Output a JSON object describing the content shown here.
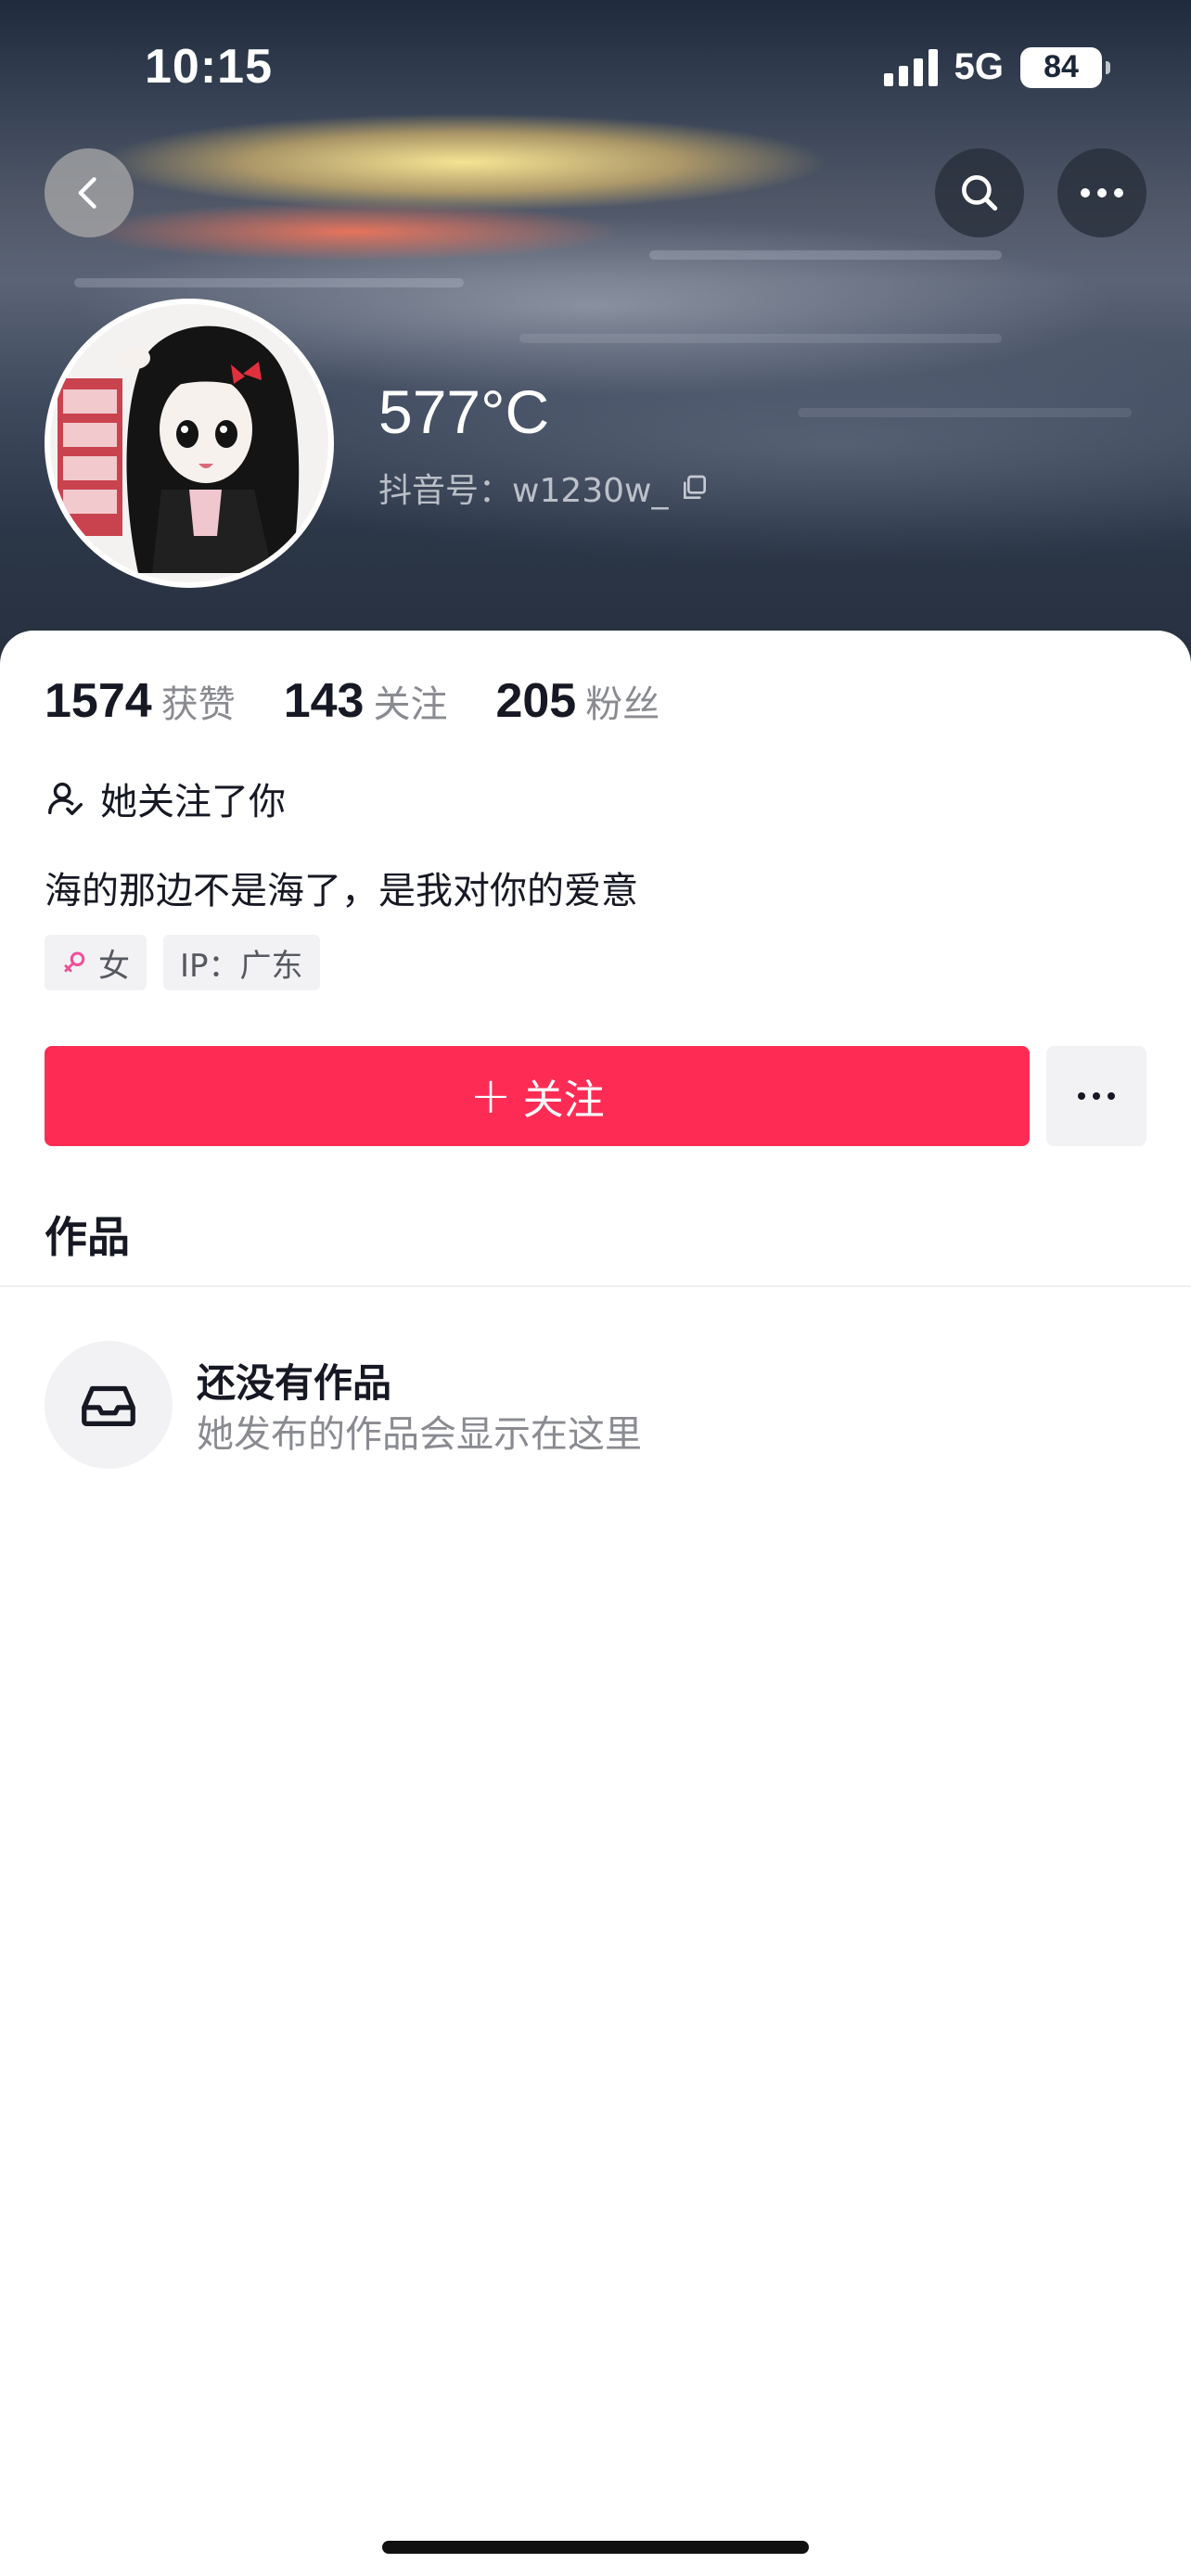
{
  "status_bar": {
    "time": "10:15",
    "network": "5G",
    "battery": "84"
  },
  "header": {
    "back_icon": "chevron-left-icon",
    "search_icon": "search-icon",
    "more_icon": "more-horizontal-icon"
  },
  "profile": {
    "nickname": "577°C",
    "douyin_id": "抖音号：w1230w_",
    "copy_icon": "copy-icon"
  },
  "stats": [
    {
      "value": "1574",
      "label": "获赞"
    },
    {
      "value": "143",
      "label": "关注"
    },
    {
      "value": "205",
      "label": "粉丝"
    }
  ],
  "follows_you": "她关注了你",
  "bio": "海的那边不是海了，是我对你的爱意",
  "tags": {
    "gender": "女",
    "ip": "IP：广东"
  },
  "actions": {
    "follow_label": "关注",
    "follow_plus": "+",
    "accent_color": "#fe2c55"
  },
  "tabs": {
    "works": "作品"
  },
  "empty_state": {
    "title": "还没有作品",
    "subtitle": "她发布的作品会显示在这里",
    "icon": "inbox-tray-icon"
  }
}
